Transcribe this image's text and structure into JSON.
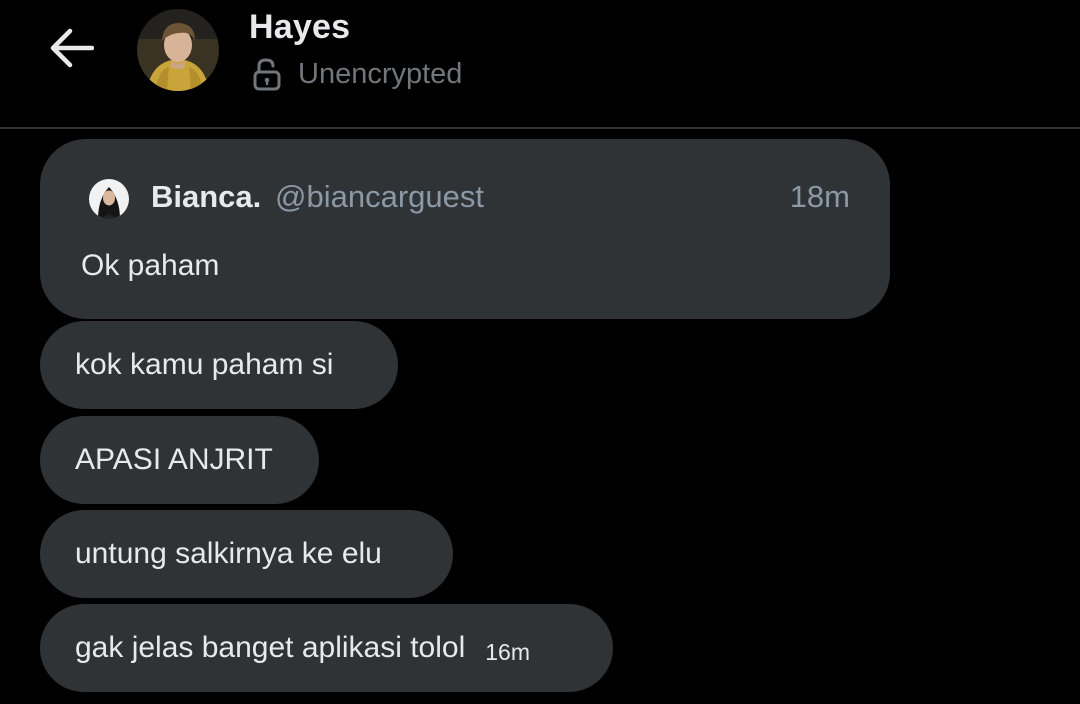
{
  "header": {
    "contact_name": "Hayes",
    "encryption_status": "Unencrypted",
    "back_icon": "arrow-left-icon",
    "lock_icon": "lock-open-icon"
  },
  "quoted_message": {
    "author_name": "Bianca.",
    "author_handle": "@biancarguest",
    "timestamp": "18m",
    "text": "Ok paham"
  },
  "messages": [
    {
      "text": "kok kamu paham si"
    },
    {
      "text": "APASI ANJRIT"
    },
    {
      "text": "untung salkirnya ke elu"
    },
    {
      "text": "gak jelas banget aplikasi tolol",
      "timestamp": "16m"
    }
  ],
  "colors": {
    "background": "#000000",
    "bubble": "#2f3336",
    "text_primary": "#e7e9ea",
    "text_secondary": "#71767b",
    "divider": "#2f3336"
  }
}
